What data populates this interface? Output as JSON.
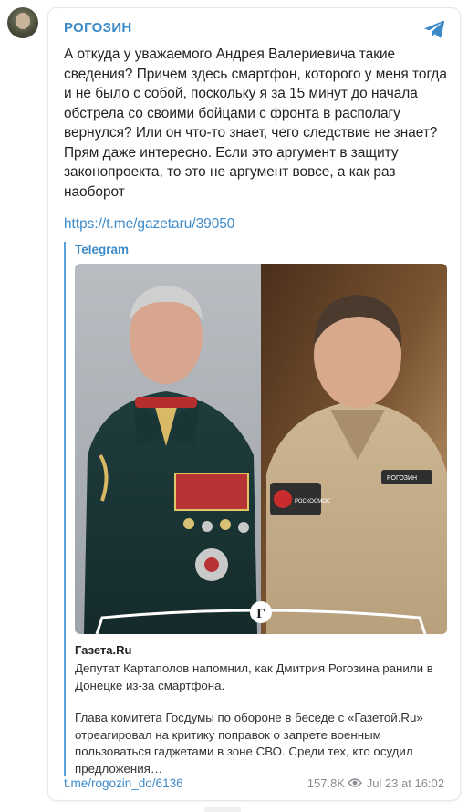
{
  "channel": {
    "name": "РОГОЗИН"
  },
  "post": {
    "text": "А откуда у уважаемого Андрея Валериевича такие сведения? Причем здесь смартфон, которого у меня тогда и не было с собой, поскольку я за 15 минут до начала обстрела со своими бойцами с фронта в располагу вернулся? Или он что-то знает, чего следствие не знает? Прям даже интересно. Если это аргумент в защиту законопроекта, то это не аргумент вовсе, а как раз наоборот",
    "link": "https://t.me/gazetaru/39050"
  },
  "preview": {
    "source": "Telegram",
    "image_badge": "Г",
    "site_name": "Газета.Ru",
    "title": "Депутат Картаполов напомнил, как Дмитрия Рогозина ранили в Донецке из-за смартфона.",
    "description": "Глава комитета Госдумы по обороне в беседе с «Газетой.Ru» отреагировал на критику поправок о запрете военным пользоваться гаджетами в зоне СВО. Среди тех, кто осудил предложения…",
    "patch_left": "РОСКОСМОС",
    "patch_right": "РОГОЗИН"
  },
  "footer": {
    "post_link": "t.me/rogozin_do/6136",
    "views": "157.8K",
    "date": "Jul 23 at 16:02"
  },
  "colors": {
    "accent": "#3d8ac9",
    "meta": "#8a8e92"
  },
  "icons": [
    "telegram-icon",
    "eye-icon"
  ]
}
